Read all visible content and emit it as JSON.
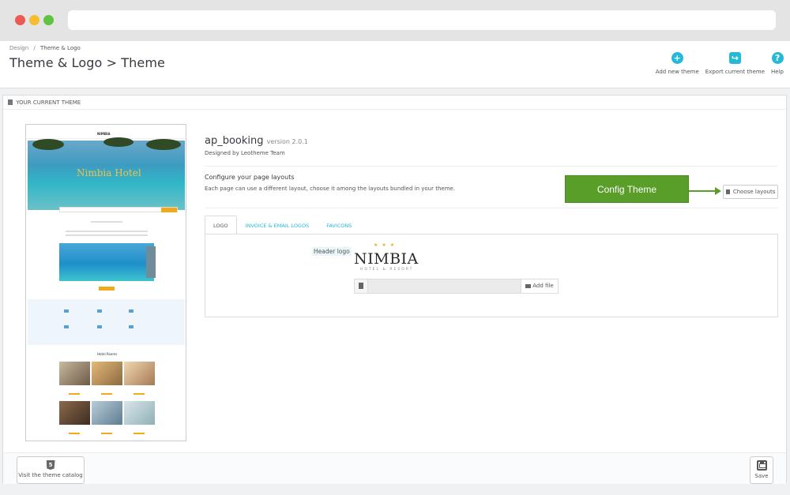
{
  "breadcrumb": {
    "parent": "Design",
    "separator": "/",
    "current": "Theme & Logo"
  },
  "page_title": "Theme & Logo > Theme",
  "toolbar": {
    "add_new_theme": "Add new theme",
    "export_theme": "Export current theme",
    "help": "Help"
  },
  "panel": {
    "heading": "Your current theme"
  },
  "preview": {
    "brand": "NIMBIA",
    "hero_title": "Nimbia Hotel",
    "section_title": "Hotel Rooms"
  },
  "theme": {
    "name": "ap_booking",
    "version": "version 2.0.1",
    "designed_by": "Designed by Leotheme Team"
  },
  "configure": {
    "title": "Configure your page layouts",
    "description": "Each page can use a different layout, choose it among the layouts bundled in your theme.",
    "callout": "Config Theme",
    "choose_layouts": "Choose layouts"
  },
  "tabs": [
    {
      "label": "Logo",
      "active": true
    },
    {
      "label": "Invoice & Email Logos",
      "active": false
    },
    {
      "label": "Favicons",
      "active": false
    }
  ],
  "logo_tab": {
    "header_logo_label": "Header logo",
    "logo_text": "NIMBIA",
    "logo_sub": "HOTEL & RESORT",
    "add_file": "Add file"
  },
  "footer": {
    "visit_catalog": "Visit the theme catalog",
    "save": "Save"
  },
  "colors": {
    "accent": "#25b9d7",
    "callout": "#5a9e2a",
    "gold": "#f3a91c"
  }
}
